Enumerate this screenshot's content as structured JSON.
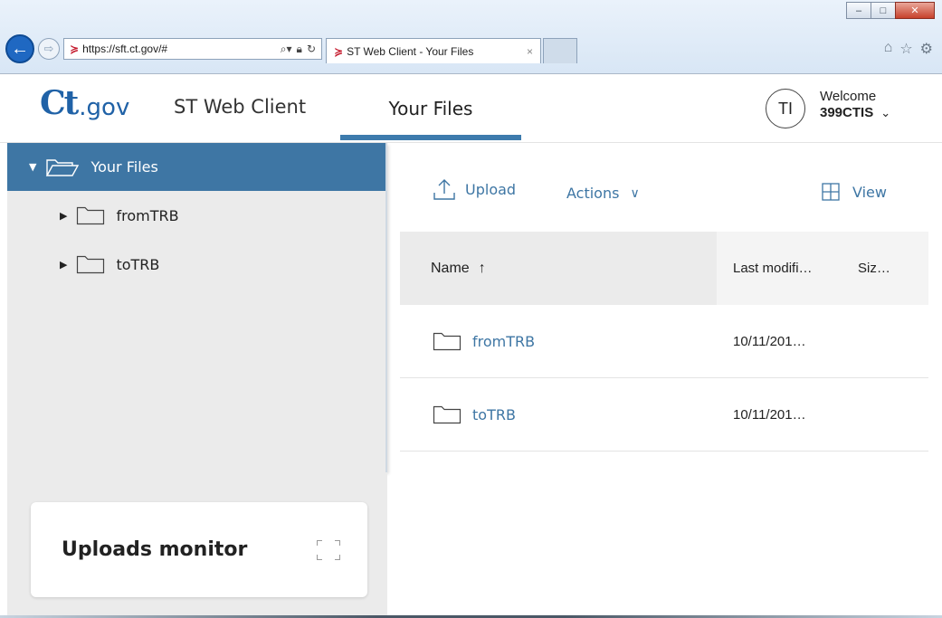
{
  "browser": {
    "url": "https://sft.ct.gov/#",
    "tab_title": "ST Web Client - Your Files",
    "tab_close": "×",
    "back_glyph": "←",
    "forward_glyph": "⇨",
    "window_controls": {
      "minimize": "–",
      "maximize": "□",
      "close": "✕"
    },
    "toolbar_icons": [
      "home-icon",
      "star-icon",
      "gear-icon"
    ]
  },
  "header": {
    "logo_ct": "Ct",
    "logo_gov": ".gov",
    "app_name": "ST Web Client",
    "active_tab": "Your Files",
    "avatar_initials": "TI",
    "welcome_label": "Welcome",
    "username": "399CTIS"
  },
  "sidebar": {
    "root": {
      "label": "Your Files",
      "expanded": true
    },
    "items": [
      {
        "label": "fromTRB",
        "expanded": false
      },
      {
        "label": "toTRB",
        "expanded": false
      }
    ]
  },
  "toolbar": {
    "upload_label": "Upload",
    "actions_label": "Actions",
    "view_label": "View"
  },
  "grid": {
    "columns": {
      "name": "Name",
      "modified": "Last modifi…",
      "size": "Siz…"
    },
    "sort_indicator": "↑",
    "rows": [
      {
        "name": "fromTRB",
        "modified": "10/11/201…",
        "size": ""
      },
      {
        "name": "toTRB",
        "modified": "10/11/201…",
        "size": ""
      }
    ]
  },
  "uploads_monitor": {
    "title": "Uploads monitor"
  },
  "colors": {
    "accent": "#3e76a4",
    "logo": "#2062a7",
    "sidebar_bg": "#ebebeb"
  }
}
